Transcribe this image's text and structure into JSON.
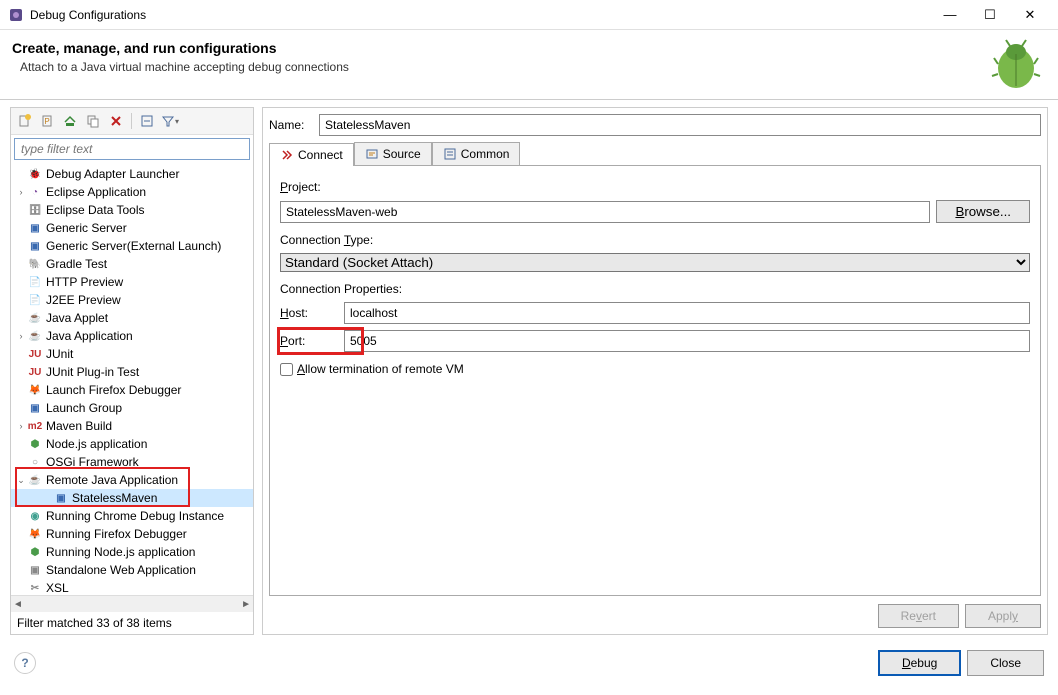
{
  "window": {
    "title": "Debug Configurations",
    "minimize": "—",
    "maximize": "☐",
    "close": "✕"
  },
  "header": {
    "title": "Create, manage, and run configurations",
    "subtitle": "Attach to a Java virtual machine accepting debug connections"
  },
  "left": {
    "filter_placeholder": "type filter text",
    "items": [
      {
        "label": "Debug Adapter Launcher",
        "icon": "bug-launcher",
        "color": "ic-green"
      },
      {
        "label": "Eclipse Application",
        "icon": "eclipse",
        "color": "ic-purple",
        "expandable": true
      },
      {
        "label": "Eclipse Data Tools",
        "icon": "db",
        "color": "ic-gray"
      },
      {
        "label": "Generic Server",
        "icon": "server",
        "color": "ic-blue"
      },
      {
        "label": "Generic Server(External Launch)",
        "icon": "server",
        "color": "ic-blue"
      },
      {
        "label": "Gradle Test",
        "icon": "gradle",
        "color": "ic-teal"
      },
      {
        "label": "HTTP Preview",
        "icon": "http",
        "color": "ic-blue"
      },
      {
        "label": "J2EE Preview",
        "icon": "j2ee",
        "color": "ic-blue"
      },
      {
        "label": "Java Applet",
        "icon": "applet",
        "color": "ic-orange"
      },
      {
        "label": "Java Application",
        "icon": "java",
        "color": "ic-blue",
        "expandable": true
      },
      {
        "label": "JUnit",
        "icon": "junit",
        "color": "ic-red"
      },
      {
        "label": "JUnit Plug-in Test",
        "icon": "junit-plugin",
        "color": "ic-red"
      },
      {
        "label": "Launch Firefox Debugger",
        "icon": "firefox",
        "color": "ic-orange"
      },
      {
        "label": "Launch Group",
        "icon": "group",
        "color": "ic-blue"
      },
      {
        "label": "Maven Build",
        "icon": "maven",
        "color": "ic-red",
        "expandable": true
      },
      {
        "label": "Node.js application",
        "icon": "node",
        "color": "ic-green"
      },
      {
        "label": "OSGi Framework",
        "icon": "osgi",
        "color": "ic-gray"
      },
      {
        "label": "Remote Java Application",
        "icon": "remote-java",
        "color": "ic-blue",
        "expandable": true,
        "expanded": true
      },
      {
        "label": "StatelessMaven",
        "icon": "java-cfg",
        "color": "ic-blue",
        "child": true,
        "selected": true
      },
      {
        "label": "Running Chrome Debug Instance",
        "icon": "chrome",
        "color": "ic-teal"
      },
      {
        "label": "Running Firefox Debugger",
        "icon": "firefox",
        "color": "ic-orange"
      },
      {
        "label": "Running Node.js application",
        "icon": "node",
        "color": "ic-green"
      },
      {
        "label": "Standalone Web Application",
        "icon": "web",
        "color": "ic-gray"
      },
      {
        "label": "XSL",
        "icon": "xsl",
        "color": "ic-gray"
      }
    ],
    "status": "Filter matched 33 of 38 items"
  },
  "right": {
    "name_label": "Name:",
    "name_value": "StatelessMaven",
    "tabs": [
      {
        "label": "Connect",
        "active": true,
        "icon": "connect"
      },
      {
        "label": "Source",
        "active": false,
        "icon": "source"
      },
      {
        "label": "Common",
        "active": false,
        "icon": "common"
      }
    ],
    "project_label": "Project:",
    "project_value": "StatelessMaven-web",
    "browse_label": "Browse...",
    "conn_type_label": "Connection Type:",
    "conn_type_value": "Standard (Socket Attach)",
    "conn_props_label": "Connection Properties:",
    "host_label_u": "H",
    "host_label": "ost:",
    "host_value": "localhost",
    "port_label_u": "P",
    "port_label": "ort:",
    "port_value": "5005",
    "allow_term_u": "A",
    "allow_term": "llow termination of remote VM",
    "revert": "Revert",
    "apply": "Apply"
  },
  "footer": {
    "debug_u": "D",
    "debug": "ebug",
    "close": "Close",
    "help": "?"
  }
}
